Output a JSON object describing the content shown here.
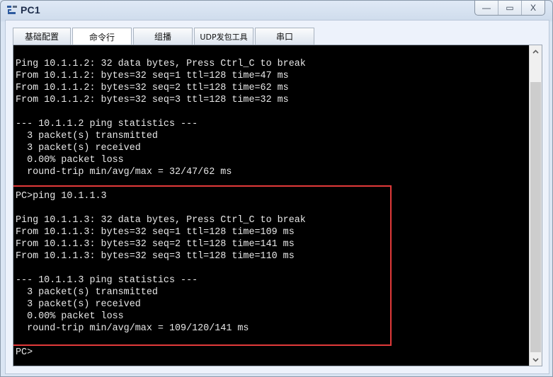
{
  "window": {
    "title": "PC1",
    "icon": "pc-network-icon",
    "controls": {
      "minimize": "—",
      "maximize": "▭",
      "close": "X"
    }
  },
  "tabs": [
    {
      "label": "基础配置",
      "active": false
    },
    {
      "label": "命令行",
      "active": true
    },
    {
      "label": "组播",
      "active": false
    },
    {
      "label": "UDP发包工具",
      "active": false
    },
    {
      "label": "串口",
      "active": false
    }
  ],
  "terminal": {
    "lines": [
      "Ping 10.1.1.2: 32 data bytes, Press Ctrl_C to break",
      "From 10.1.1.2: bytes=32 seq=1 ttl=128 time=47 ms",
      "From 10.1.1.2: bytes=32 seq=2 ttl=128 time=62 ms",
      "From 10.1.1.2: bytes=32 seq=3 ttl=128 time=32 ms",
      "",
      "--- 10.1.1.2 ping statistics ---",
      "  3 packet(s) transmitted",
      "  3 packet(s) received",
      "  0.00% packet loss",
      "  round-trip min/avg/max = 32/47/62 ms",
      "",
      "PC>ping 10.1.1.3",
      "",
      "Ping 10.1.1.3: 32 data bytes, Press Ctrl_C to break",
      "From 10.1.1.3: bytes=32 seq=1 ttl=128 time=109 ms",
      "From 10.1.1.3: bytes=32 seq=2 ttl=128 time=141 ms",
      "From 10.1.1.3: bytes=32 seq=3 ttl=128 time=110 ms",
      "",
      "--- 10.1.1.3 ping statistics ---",
      "  3 packet(s) transmitted",
      "  3 packet(s) received",
      "  0.00% packet loss",
      "  round-trip min/avg/max = 109/120/141 ms",
      "",
      "PC>"
    ],
    "highlight_color": "#e23a3a",
    "scrollbar": {
      "up": "⌃",
      "down": "⌄"
    }
  }
}
